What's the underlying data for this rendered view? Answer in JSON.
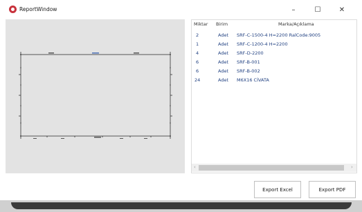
{
  "window": {
    "title": "ReportWindow",
    "controls": {
      "minimize": "–",
      "maximize": "☐",
      "close": "✕"
    }
  },
  "table": {
    "headers": {
      "miktar": "Miktar",
      "birim": "Birim",
      "marka": "Marka/Açıklama"
    },
    "rows": [
      {
        "miktar": "2",
        "birim": "Adet",
        "marka": "SRF-C-1500-4 H=2200 RalCode:9005"
      },
      {
        "miktar": "1",
        "birim": "Adet",
        "marka": "SRF-C-1200-4 H=2200"
      },
      {
        "miktar": "4",
        "birim": "Adet",
        "marka": "SRF-D-2200"
      },
      {
        "miktar": "6",
        "birim": "Adet",
        "marka": "SRF-B-001"
      },
      {
        "miktar": "6",
        "birim": "Adet",
        "marka": "SRF-B-002"
      },
      {
        "miktar": "24",
        "birim": "Adet",
        "marka": "M6X16 CİVATA"
      }
    ],
    "scroll_left": "‹",
    "scroll_right": "›"
  },
  "buttons": {
    "export_excel": "Export Excel",
    "export_pdf": "Export PDF"
  },
  "colors": {
    "accent": "#c8323c",
    "cell_text": "#1f3f80",
    "preview_bg": "#e3e3e3"
  }
}
